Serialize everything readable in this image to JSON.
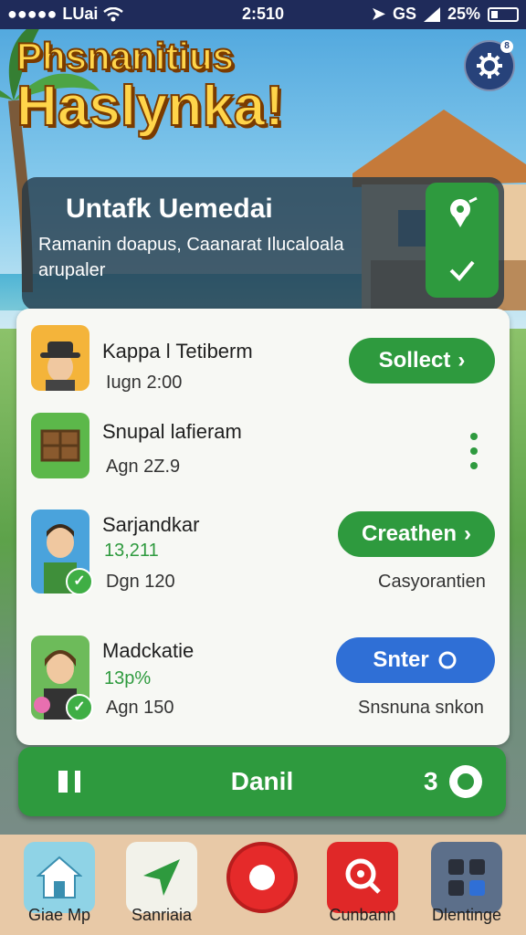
{
  "status_bar": {
    "carrier": "LUai",
    "time": "2:510",
    "signal_text": "GS",
    "battery": "25%"
  },
  "header": {
    "title_line1": "Phsnanitius",
    "title_line2": "Haslynka!",
    "settings_badge": "8"
  },
  "banner": {
    "heading": "Untafk Uemedai",
    "subtext": "Ramanin doapus, Caanarat Ilucaloala arupaler"
  },
  "list": [
    {
      "name": "Kappa l Tetiberm",
      "meta": "Iugn 2:00",
      "action": "Sollect"
    },
    {
      "name": "Snupal lafieram",
      "meta": "Agn 2Z.9"
    },
    {
      "name": "Sarjandkar",
      "stat": "13,211",
      "meta": "Dgn 120",
      "action": "Creathen",
      "note": "Casyorantien"
    },
    {
      "name": "Madckatie",
      "stat": "13p%",
      "meta": "Agn 150",
      "action": "Snter",
      "note": "Snsnuna snkon"
    }
  ],
  "footer": {
    "label": "Danil",
    "count": "3"
  },
  "dock": [
    {
      "label": "Giae Mp",
      "icon": "home-icon"
    },
    {
      "label": "Sanriaia",
      "icon": "navigate-icon"
    },
    {
      "label": "",
      "icon": "record-icon"
    },
    {
      "label": "Cunbann",
      "icon": "search-icon"
    },
    {
      "label": "Dlentinge",
      "icon": "grid-icon"
    }
  ],
  "colors": {
    "accent_green": "#2e9a3e",
    "accent_blue": "#2f6fd6",
    "status_bar": "#1f2b5a",
    "title_yellow": "#ffd54a"
  }
}
